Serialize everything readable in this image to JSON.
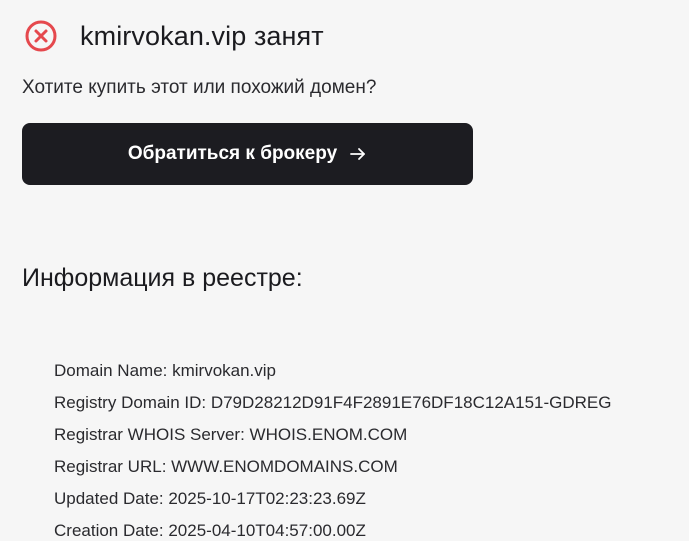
{
  "status": {
    "icon": "error-circle-x-icon",
    "title": "kmirvokan.vip занят",
    "color": "#e5484d"
  },
  "offer": {
    "question": "Хотите купить этот или похожий домен?",
    "button_label": "Обратиться к брокеру",
    "button_icon": "arrow-right-icon"
  },
  "registry": {
    "heading": "Информация в реестре:",
    "lines": [
      "Domain Name: kmirvokan.vip",
      "Registry Domain ID: D79D28212D91F4F2891E76DF18C12A151-GDREG",
      "Registrar WHOIS Server: WHOIS.ENOM.COM",
      "Registrar URL: WWW.ENOMDOMAINS.COM",
      "Updated Date: 2025-10-17T02:23:23.69Z",
      "Creation Date: 2025-04-10T04:57:00.00Z"
    ]
  }
}
